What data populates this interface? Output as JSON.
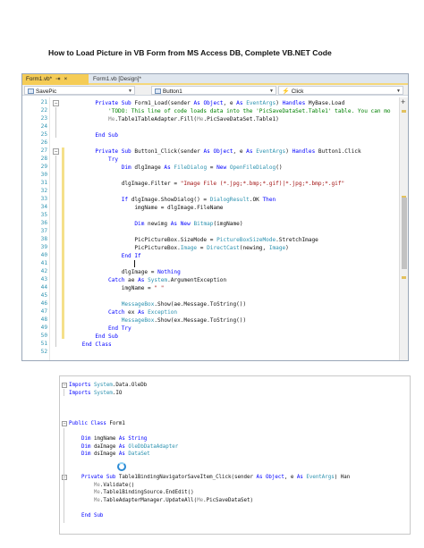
{
  "document": {
    "title": "How to Load Picture in VB Form from MS Access DB, Complete VB.NET Code"
  },
  "editor": {
    "tabs": [
      {
        "label": "Form1.vb*",
        "pin": "⇥",
        "close": "×"
      },
      {
        "label": "Form1.vb [Design]*"
      }
    ],
    "nav": {
      "class_dropdown": "SavePic",
      "object_dropdown": "Button1",
      "event_dropdown": "Click"
    },
    "lines": [
      {
        "n": "21",
        "text": "        Private Sub Form1_Load(sender As Object, e As EventArgs) Handles MyBase.Load"
      },
      {
        "n": "22",
        "text": "            'TODO: This line of code loads data into the 'PicSaveDataSet.Table1' table. You can mo"
      },
      {
        "n": "23",
        "text": "            Me.Table1TableAdapter.Fill(Me.PicSaveDataSet.Table1)"
      },
      {
        "n": "24",
        "text": ""
      },
      {
        "n": "25",
        "text": "        End Sub"
      },
      {
        "n": "26",
        "text": ""
      },
      {
        "n": "27",
        "text": "        Private Sub Button1_Click(sender As Object, e As EventArgs) Handles Button1.Click"
      },
      {
        "n": "28",
        "text": "            Try"
      },
      {
        "n": "29",
        "text": "                Dim dlgImage As FileDialog = New OpenFileDialog()"
      },
      {
        "n": "30",
        "text": ""
      },
      {
        "n": "31",
        "text": "                dlgImage.Filter = \"Image File (*.jpg;*.bmp;*.gif)|*.jpg;*.bmp;*.gif\""
      },
      {
        "n": "32",
        "text": ""
      },
      {
        "n": "33",
        "text": "                If dlgImage.ShowDialog() = DialogResult.OK Then"
      },
      {
        "n": "34",
        "text": "                    imgName = dlgImage.FileName"
      },
      {
        "n": "35",
        "text": ""
      },
      {
        "n": "36",
        "text": "                    Dim newimg As New Bitmap(imgName)"
      },
      {
        "n": "37",
        "text": ""
      },
      {
        "n": "38",
        "text": "                    PicPictureBox.SizeMode = PictureBoxSizeMode.StretchImage"
      },
      {
        "n": "39",
        "text": "                    PicPictureBox.Image = DirectCast(newimg, Image)"
      },
      {
        "n": "40",
        "text": "                End If"
      },
      {
        "n": "41",
        "text": ""
      },
      {
        "n": "42",
        "text": "                dlgImage = Nothing"
      },
      {
        "n": "43",
        "text": "            Catch ae As System.ArgumentException"
      },
      {
        "n": "44",
        "text": "                imgName = \" \""
      },
      {
        "n": "45",
        "text": ""
      },
      {
        "n": "46",
        "text": "                MessageBox.Show(ae.Message.ToString())"
      },
      {
        "n": "47",
        "text": "            Catch ex As Exception"
      },
      {
        "n": "48",
        "text": "                MessageBox.Show(ex.Message.ToString())"
      },
      {
        "n": "49",
        "text": "            End Try"
      },
      {
        "n": "50",
        "text": "        End Sub"
      },
      {
        "n": "51",
        "text": "    End Class"
      },
      {
        "n": "52",
        "text": ""
      }
    ]
  },
  "snippet": {
    "lines": [
      {
        "text": "Imports System.Data.OleDb",
        "fold": "-"
      },
      {
        "text": "Imports System.IO"
      },
      {
        "text": ""
      },
      {
        "text": ""
      },
      {
        "text": ""
      },
      {
        "text": "Public Class Form1",
        "fold": "-"
      },
      {
        "text": ""
      },
      {
        "text": "    Dim imgName As String"
      },
      {
        "text": "    Dim daImage As OleDbDataAdapter"
      },
      {
        "text": "    Dim dsImage As DataSet"
      },
      {
        "text": ""
      },
      {
        "text": ""
      },
      {
        "text": "    Private Sub Table1BindingNavigatorSaveItem_Click(sender As Object, e As EventArgs) Han",
        "fold": "-"
      },
      {
        "text": "        Me.Validate()"
      },
      {
        "text": "        Me.Table1BindingSource.EndEdit()"
      },
      {
        "text": "        Me.TableAdapterManager.UpdateAll(Me.PicSaveDataSet)"
      },
      {
        "text": ""
      },
      {
        "text": "    End Sub"
      }
    ]
  },
  "colors": {
    "keyword": "#0000ff",
    "type": "#2b91af",
    "string": "#a31515",
    "comment": "#008000",
    "active_tab": "#f5cc56"
  }
}
